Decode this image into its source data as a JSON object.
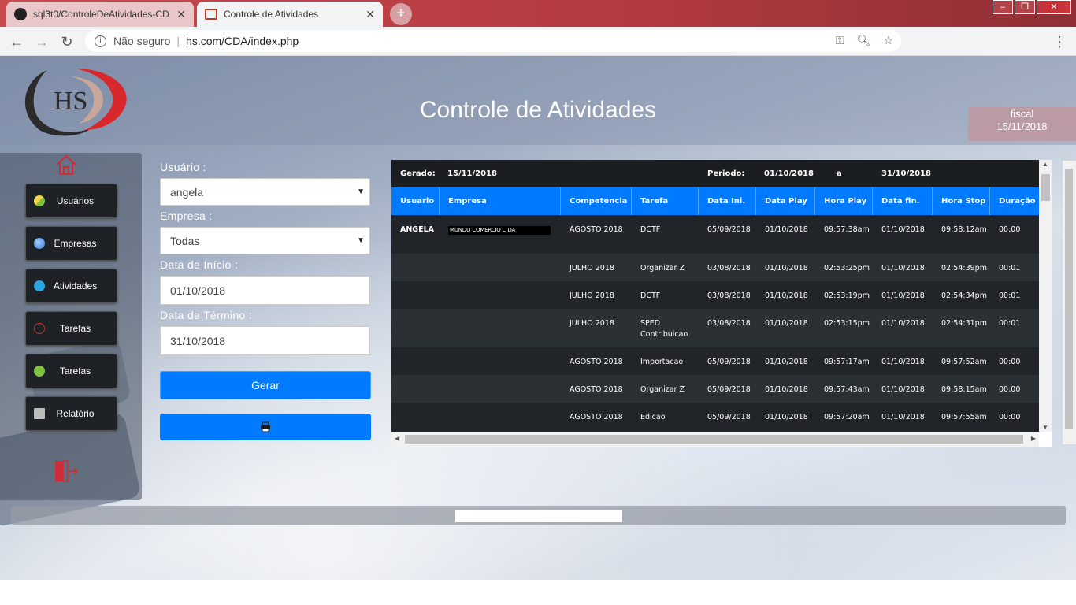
{
  "browser": {
    "tabs": [
      {
        "title": "sql3t0/ControleDeAtividades-CD",
        "active": false
      },
      {
        "title": "Controle de Atividades",
        "active": true
      }
    ],
    "security_label": "Não seguro",
    "url": "hs.com/CDA/index.php"
  },
  "header": {
    "title": "Controle de Atividades",
    "user": "fiscal",
    "date": "15/11/2018",
    "logo_text": "HS"
  },
  "sidebar": {
    "items": [
      {
        "label": "Usuários",
        "icon": "users-icon"
      },
      {
        "label": "Empresas",
        "icon": "globe-icon"
      },
      {
        "label": "Atividades",
        "icon": "activity-icon"
      },
      {
        "label": "Tarefas",
        "icon": "task-check-outline-icon"
      },
      {
        "label": "Tarefas",
        "icon": "task-check-icon"
      },
      {
        "label": "Relatório",
        "icon": "report-icon"
      }
    ]
  },
  "form": {
    "usuario_label": "Usuário :",
    "usuario_value": "angela",
    "empresa_label": "Empresa :",
    "empresa_value": "Todas",
    "inicio_label": "Data de Início :",
    "inicio_value": "01/10/2018",
    "termino_label": "Data de Término :",
    "termino_value": "31/10/2018",
    "gerar_label": "Gerar",
    "print_icon": "printer-icon"
  },
  "report": {
    "gerado_label": "Gerado:",
    "gerado_value": "15/11/2018",
    "periodo_label": "Periodo:",
    "periodo_inicio": "01/10/2018",
    "periodo_sep": "a",
    "periodo_fim": "31/10/2018",
    "columns": [
      "Usuario",
      "Empresa",
      "Competencia",
      "Tarefa",
      "Data Ini.",
      "Data Play",
      "Hora Play",
      "Data fin.",
      "Hora Stop",
      "Duração"
    ],
    "rows": [
      {
        "usuario": "ANGELA",
        "empresa": "MUNDO COMERCIO LTDA",
        "competencia": "AGOSTO 2018",
        "tarefa": "DCTF",
        "data_ini": "05/09/2018",
        "data_play": "01/10/2018",
        "hora_play": "09:57:38am",
        "data_fin": "01/10/2018",
        "hora_stop": "09:58:12am",
        "duracao": "00:00"
      },
      {
        "usuario": "",
        "empresa": "",
        "competencia": "JULHO 2018",
        "tarefa": "Organizar Z",
        "data_ini": "03/08/2018",
        "data_play": "01/10/2018",
        "hora_play": "02:53:25pm",
        "data_fin": "01/10/2018",
        "hora_stop": "02:54:39pm",
        "duracao": "00:01"
      },
      {
        "usuario": "",
        "empresa": "",
        "competencia": "JULHO 2018",
        "tarefa": "DCTF",
        "data_ini": "03/08/2018",
        "data_play": "01/10/2018",
        "hora_play": "02:53:19pm",
        "data_fin": "01/10/2018",
        "hora_stop": "02:54:34pm",
        "duracao": "00:01"
      },
      {
        "usuario": "",
        "empresa": "",
        "competencia": "JULHO 2018",
        "tarefa": "SPED Contribuicao",
        "data_ini": "03/08/2018",
        "data_play": "01/10/2018",
        "hora_play": "02:53:15pm",
        "data_fin": "01/10/2018",
        "hora_stop": "02:54:31pm",
        "duracao": "00:01"
      },
      {
        "usuario": "",
        "empresa": "",
        "competencia": "AGOSTO 2018",
        "tarefa": "Importacao",
        "data_ini": "05/09/2018",
        "data_play": "01/10/2018",
        "hora_play": "09:57:17am",
        "data_fin": "01/10/2018",
        "hora_stop": "09:57:52am",
        "duracao": "00:00"
      },
      {
        "usuario": "",
        "empresa": "",
        "competencia": "AGOSTO 2018",
        "tarefa": "Organizar Z",
        "data_ini": "05/09/2018",
        "data_play": "01/10/2018",
        "hora_play": "09:57:43am",
        "data_fin": "01/10/2018",
        "hora_stop": "09:58:15am",
        "duracao": "00:00"
      },
      {
        "usuario": "",
        "empresa": "",
        "competencia": "AGOSTO 2018",
        "tarefa": "Edicao",
        "data_ini": "05/09/2018",
        "data_play": "01/10/2018",
        "hora_play": "09:57:20am",
        "data_fin": "01/10/2018",
        "hora_stop": "09:57:55am",
        "duracao": "00:00"
      }
    ]
  }
}
